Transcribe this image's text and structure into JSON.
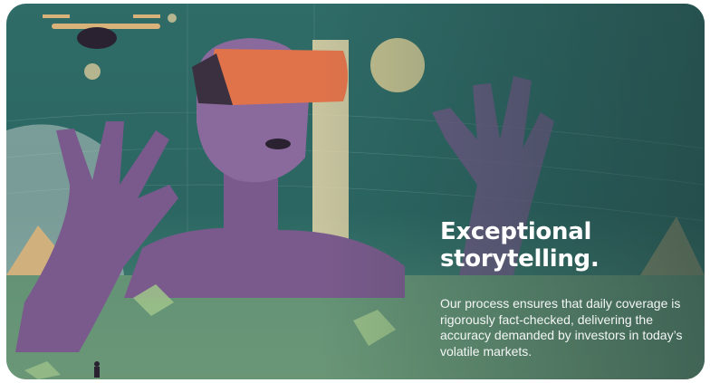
{
  "card": {
    "headline": "Exceptional\nstorytelling.",
    "body": "Our process ensures that daily coverage is rigorously fact-checked, delivering the accuracy demanded by investors in today’s volatile markets."
  },
  "illustration": {
    "subject": "vr-headset-figure",
    "colors": {
      "background": "#2f6b67",
      "figure": "#7a5a8c",
      "visor": "#e0734a",
      "skin_highlight": "#d9b27a",
      "ground": "#6f9a78"
    }
  }
}
